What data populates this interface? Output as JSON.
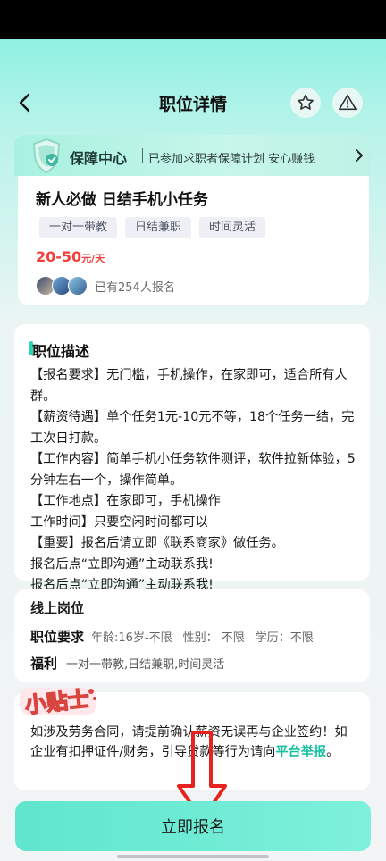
{
  "nav": {
    "title": "职位详情"
  },
  "guarantee": {
    "title": "保障中心",
    "subtitle": "已参加求职者保障计划 安心赚钱"
  },
  "job": {
    "title": "新人必做 日结手机小任务",
    "tags": [
      "一对一带教",
      "日结兼职",
      "时间灵活"
    ],
    "salary": "20-50",
    "salary_unit": "元/天",
    "signups": "已有254人报名"
  },
  "description": {
    "title": "职位描述",
    "text": "【报名要求】无门槛，手机操作，在家即可，适合所有人群。\n【薪资待遇】单个任务1元-10元不等，18个任务一结，完工次日打款。\n【工作内容】简单手机小任务软件测评，软件拉新体验，5分钟左右一个，操作简单。\n【工作地点】在家即可，手机操作\n工作时间】只要空闲时间都可以\n【重要】报名后请立即《联系商家》做任务。\n报名后点“立即沟通”主动联系我!\n报名后点“立即沟通”主动联系我!"
  },
  "online": {
    "title": "线上岗位",
    "req_label": "职位要求",
    "age": "年龄:16岁-不限",
    "gender": "性别： 不限",
    "education": "学历：不限",
    "benefit_label": "福利",
    "benefits": "一对一带教,日结兼职,时间灵活"
  },
  "notice": {
    "sticker": "小贴士",
    "text": "如涉及劳务合同，请提前确认薪资无误再与企业签约！如企业有扣押证件/财务，引导贷款等行为请向",
    "link": "平台举报",
    "end": "。"
  },
  "apply_label": "立即报名",
  "colors": {
    "accent": "#29d6b4",
    "salary": "#f0403c",
    "arrow": "#e8231f"
  }
}
